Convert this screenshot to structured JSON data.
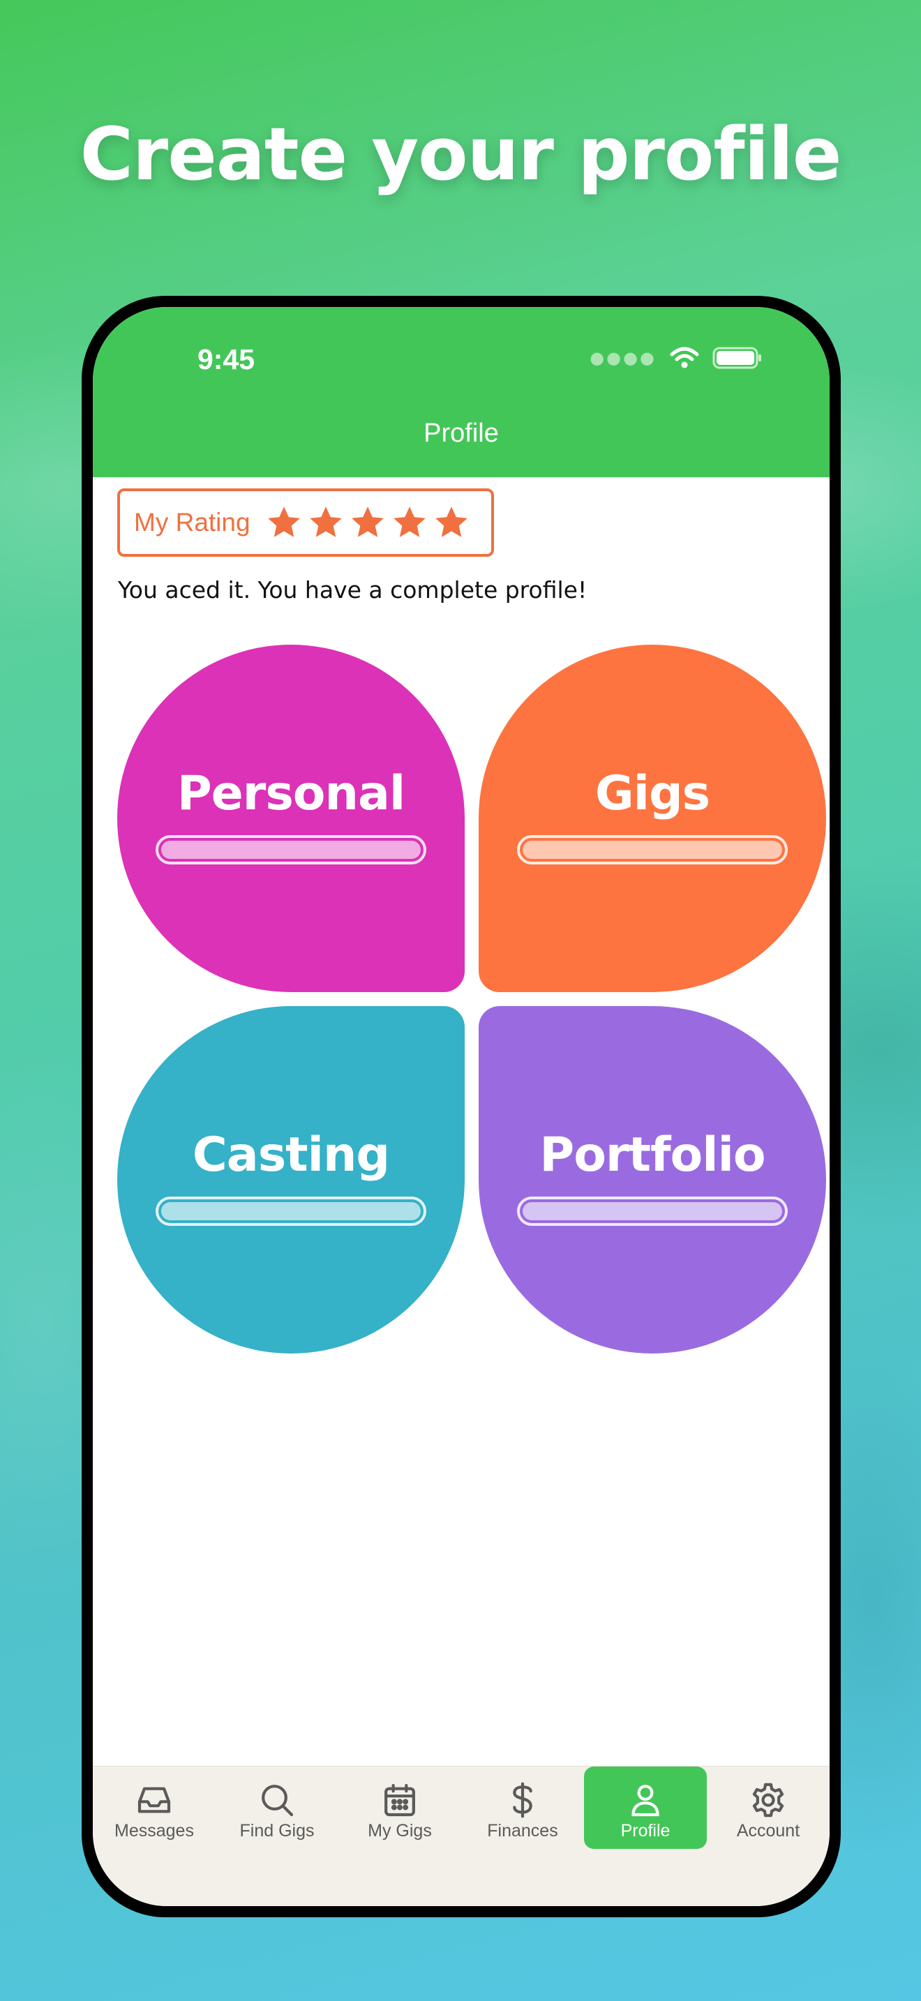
{
  "headline": "Create your profile",
  "status_bar": {
    "time": "9:45"
  },
  "nav": {
    "title": "Profile"
  },
  "rating": {
    "label": "My Rating",
    "stars": 5,
    "max_stars": 5
  },
  "profile_message": "You aced it. You have a complete profile!",
  "sections": [
    {
      "label": "Personal",
      "color": "#db32b8",
      "progress": 1.0
    },
    {
      "label": "Gigs",
      "color": "#fd7440",
      "progress": 1.0
    },
    {
      "label": "Casting",
      "color": "#35b1c8",
      "progress": 1.0
    },
    {
      "label": "Portfolio",
      "color": "#9a6be0",
      "progress": 1.0
    }
  ],
  "tabs": [
    {
      "label": "Messages",
      "icon": "inbox-icon"
    },
    {
      "label": "Find Gigs",
      "icon": "search-icon"
    },
    {
      "label": "My Gigs",
      "icon": "calendar-icon"
    },
    {
      "label": "Finances",
      "icon": "dollar-icon"
    },
    {
      "label": "Profile",
      "icon": "person-icon",
      "active": true
    },
    {
      "label": "Account",
      "icon": "gear-icon"
    }
  ],
  "colors": {
    "brand_green": "#43c658",
    "rating_orange": "#f0703f",
    "tab_bar_bg": "#f2f0e8"
  }
}
